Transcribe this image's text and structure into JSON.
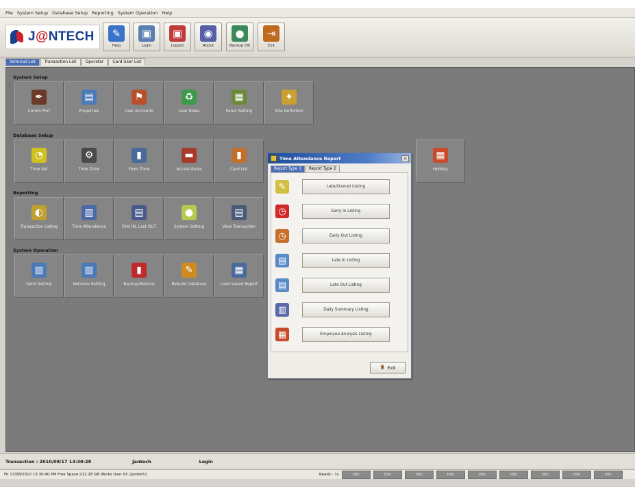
{
  "menu": [
    "File",
    "System Setup",
    "Database Setup",
    "Reporting",
    "System Operation",
    "Help"
  ],
  "logo": {
    "prefix": "J",
    "at": "@",
    "suffix": "NTECH"
  },
  "toolbar": [
    {
      "label": "Help",
      "icon": "help-book-icon",
      "color": "#3a74c8",
      "glyph": "✎"
    },
    {
      "label": "Login",
      "icon": "login-icon",
      "color": "#5a7fb0",
      "glyph": "▣"
    },
    {
      "label": "Logout",
      "icon": "logout-icon",
      "color": "#c03a3a",
      "glyph": "▣"
    },
    {
      "label": "About",
      "icon": "about-icon",
      "color": "#5560a8",
      "glyph": "◉"
    },
    {
      "label": "Backup DB",
      "icon": "globe-icon",
      "color": "#3c8a5a",
      "glyph": "●"
    },
    {
      "label": "Exit",
      "icon": "exit-door-icon",
      "color": "#c06a20",
      "glyph": "⇥"
    }
  ],
  "tabs": [
    "Terminal List",
    "Transaction List",
    "Operator",
    "Card User List"
  ],
  "sections": [
    {
      "label": "System Setup",
      "buttons": [
        {
          "label": "Comm Port",
          "icon": "wrench-icon",
          "color": "#6a3a2a",
          "glyph": "✒"
        },
        {
          "label": "Properties",
          "icon": "properties-icon",
          "color": "#4a7ab8",
          "glyph": "▤"
        },
        {
          "label": "User Accounts",
          "icon": "user-accounts-icon",
          "color": "#b8502a",
          "glyph": "⚑"
        },
        {
          "label": "User Roles",
          "icon": "recycle-icon",
          "color": "#3c9a4a",
          "glyph": "♻"
        },
        {
          "label": "Panel Setting",
          "icon": "panel-icon",
          "color": "#6a8a3a",
          "glyph": "▦"
        },
        {
          "label": "Site Definition",
          "icon": "site-icon",
          "color": "#c8a030",
          "glyph": "✦"
        }
      ]
    },
    {
      "label": "Database Setup",
      "buttons": [
        {
          "label": "Time Set",
          "icon": "clock-icon",
          "color": "#d0c020",
          "glyph": "◔"
        },
        {
          "label": "Time Zone",
          "icon": "time-zone-icon",
          "color": "#4a4a4a",
          "glyph": "⚙"
        },
        {
          "label": "Floor Zone",
          "icon": "floor-zone-icon",
          "color": "#4a6a9a",
          "glyph": "▮"
        },
        {
          "label": "Access Rules",
          "icon": "access-rules-icon",
          "color": "#a83a2a",
          "glyph": "▬"
        },
        {
          "label": "Card List",
          "icon": "card-list-icon",
          "color": "#c0702a",
          "glyph": "▮"
        },
        {
          "label": "Holiday",
          "icon": "holiday-icon",
          "color": "#c84a2a",
          "glyph": "▦"
        }
      ]
    },
    {
      "label": "Reporting",
      "buttons": [
        {
          "label": "Transaction Listing",
          "icon": "transaction-listing-icon",
          "color": "#c0a030",
          "glyph": "◐"
        },
        {
          "label": "Time Attendance",
          "icon": "time-attendance-icon",
          "color": "#4a6aa8",
          "glyph": "▥"
        },
        {
          "label": "First IN, Last OUT",
          "icon": "first-in-last-out-icon",
          "color": "#4a5a8a",
          "glyph": "▤"
        },
        {
          "label": "System Setting",
          "icon": "system-setting-icon",
          "color": "#b8c850",
          "glyph": "●"
        },
        {
          "label": "View Transaction",
          "icon": "view-transaction-icon",
          "color": "#4a5a7a",
          "glyph": "▤"
        }
      ]
    },
    {
      "label": "System Operation",
      "buttons": [
        {
          "label": "Send Setting",
          "icon": "send-setting-icon",
          "color": "#4a7ab8",
          "glyph": "▥"
        },
        {
          "label": "Retrieve Setting",
          "icon": "retrieve-setting-icon",
          "color": "#4a7ab8",
          "glyph": "▥"
        },
        {
          "label": "Backup/Restore",
          "icon": "backup-restore-icon",
          "color": "#c02a2a",
          "glyph": "▮"
        },
        {
          "label": "Rebuild Database",
          "icon": "pencil-icon",
          "color": "#d08a20",
          "glyph": "✎"
        },
        {
          "label": "Load Saved Report",
          "icon": "load-report-icon",
          "color": "#4a6a9a",
          "glyph": "▦"
        }
      ]
    }
  ],
  "dialog": {
    "title": "Time Attendance Report",
    "close": "×",
    "tabs": [
      "Report Type 1",
      "Report Type 2"
    ],
    "buttons": [
      {
        "label": "Late/Overall Listing",
        "icon": "pencil-icon",
        "color": "#d0c040",
        "glyph": "✎"
      },
      {
        "label": "Early In Listing",
        "icon": "alarm-clock-icon",
        "color": "#d02a2a",
        "glyph": "◷"
      },
      {
        "label": "Early Out Listing",
        "icon": "alarm-clock-icon",
        "color": "#c8702a",
        "glyph": "◷"
      },
      {
        "label": "Late In Listing",
        "icon": "document-icon",
        "color": "#5a8ac8",
        "glyph": "▤"
      },
      {
        "label": "Late Out Listing",
        "icon": "document-icon",
        "color": "#5a8ac8",
        "glyph": "▤"
      },
      {
        "label": "Daily Summary Listing",
        "icon": "document-icon",
        "color": "#5a6aa8",
        "glyph": "▥"
      },
      {
        "label": "Employee Analysis Listing",
        "icon": "calendar-icon",
        "color": "#c84a2a",
        "glyph": "▦"
      }
    ],
    "exit": "Exit"
  },
  "status1": {
    "transaction": "Transaction : 2010/08/17 13:30:28",
    "user": "Jantech",
    "state": "Login"
  },
  "status2": {
    "left": "Fri 17/08/2010 13:30:40 PM  Free Space:212.28 GB  Works User ID: [Jantech]",
    "ready": "Ready : 1s",
    "segments": [
      "Idle",
      "Idle",
      "Idle",
      "Idle",
      "Idle",
      "Idle",
      "Idle",
      "Idle",
      "Idle"
    ]
  }
}
